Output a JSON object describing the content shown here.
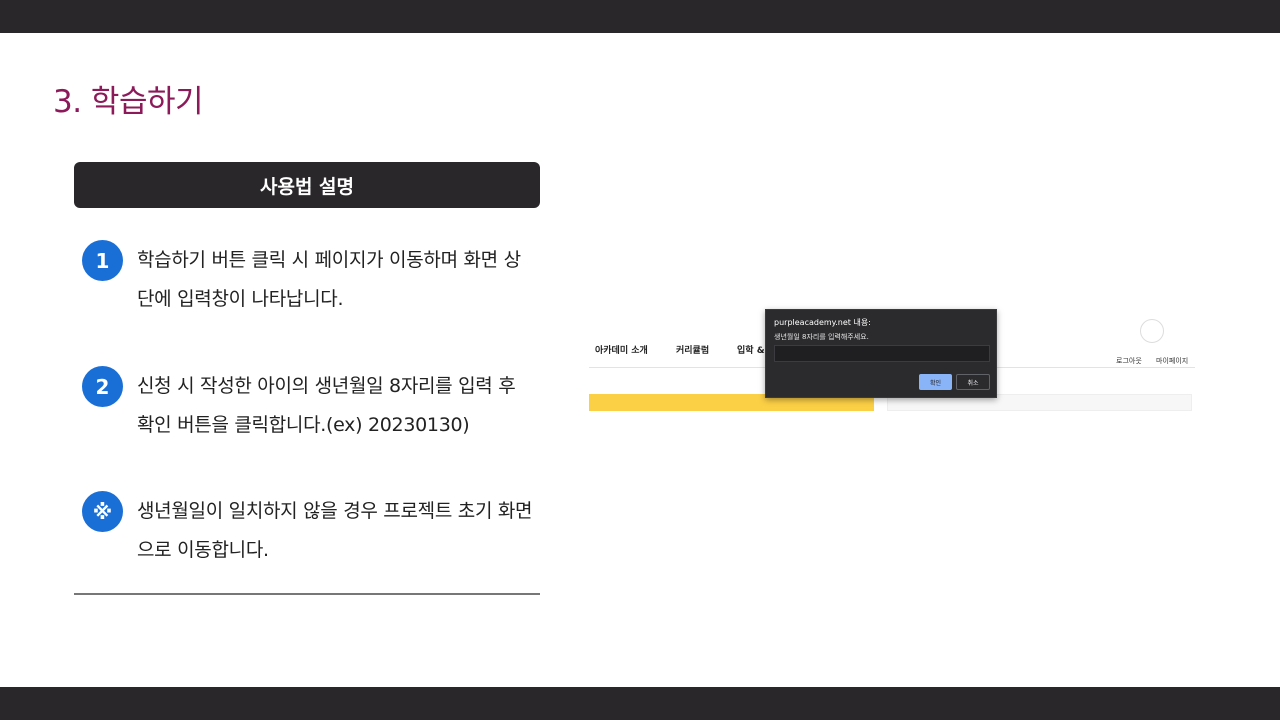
{
  "slide": {
    "title": "3. 학습하기",
    "guide_header": "사용법 설명",
    "steps": [
      {
        "badge": "1",
        "text": "학습하기 버튼 클릭 시 페이지가 이동하며 화면 상단에 입력창이 나타납니다."
      },
      {
        "badge": "2",
        "text": "신청 시 작성한 아이의 생년월일 8자리를 입력 후 확인 버튼을 클릭합니다.(ex) 20230130)"
      },
      {
        "badge": "※",
        "text": "생년월일이 일치하지 않을 경우 프로젝트 초기 화면으로 이동합니다."
      }
    ],
    "colors": {
      "title": "#8c1a5a",
      "badge": "#1a6fd6",
      "bars": "#2a272b"
    }
  },
  "screenshot": {
    "nav": [
      "아카데미 소개",
      "커리큘럼",
      "입학 &"
    ],
    "util": [
      "로그아웃",
      "마이페이지"
    ],
    "dialog": {
      "title": "purpleacademy.net 내용:",
      "message": "생년월일 8자리를 입력해주세요.",
      "input_value": "",
      "ok_label": "확인",
      "cancel_label": "취소"
    }
  }
}
